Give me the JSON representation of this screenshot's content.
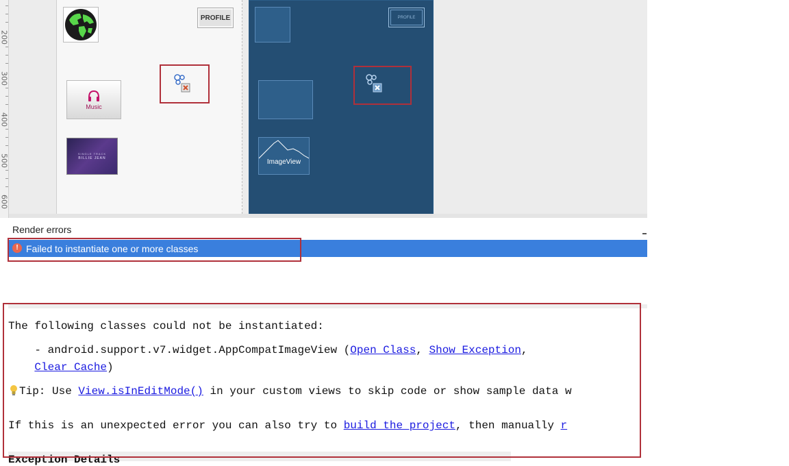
{
  "ruler": {
    "labels": [
      "200",
      "300",
      "400",
      "500",
      "600"
    ]
  },
  "design": {
    "profile_label": "PROFILE",
    "music_label": "Music",
    "album_line1": "SINGLE TRACK",
    "album_line2": "BILLIE JEAN"
  },
  "blueprint": {
    "profile_label": "PROFILE",
    "imageview_label": "ImageView"
  },
  "render_errors": {
    "title": "Render errors",
    "error_message": "Failed to instantiate one or more classes"
  },
  "details": {
    "line1": "The following classes could not be instantiated:",
    "class_prefix": "    - android.support.v7.widget.AppCompatImageView (",
    "open_class": "Open Class",
    "comma1": ", ",
    "show_exception": "Show Exception",
    "comma2": ",",
    "indent": "    ",
    "clear_cache": "Clear Cache",
    "close_paren": ")",
    "tip_prefix": "Tip: Use ",
    "tip_link": "View.isInEditMode()",
    "tip_suffix": " in your custom views to skip code or show sample data w",
    "build_prefix": "If this is an unexpected error you can also try to ",
    "build_link": "build the project",
    "build_suffix": ", then manually ",
    "build_trail": "r",
    "exception_heading": "Exception Details"
  },
  "colors": {
    "selection": "#3a7fdd",
    "highlight_box": "#b0303a",
    "blueprint_bg": "#244e73",
    "link": "#1a1ae0"
  }
}
